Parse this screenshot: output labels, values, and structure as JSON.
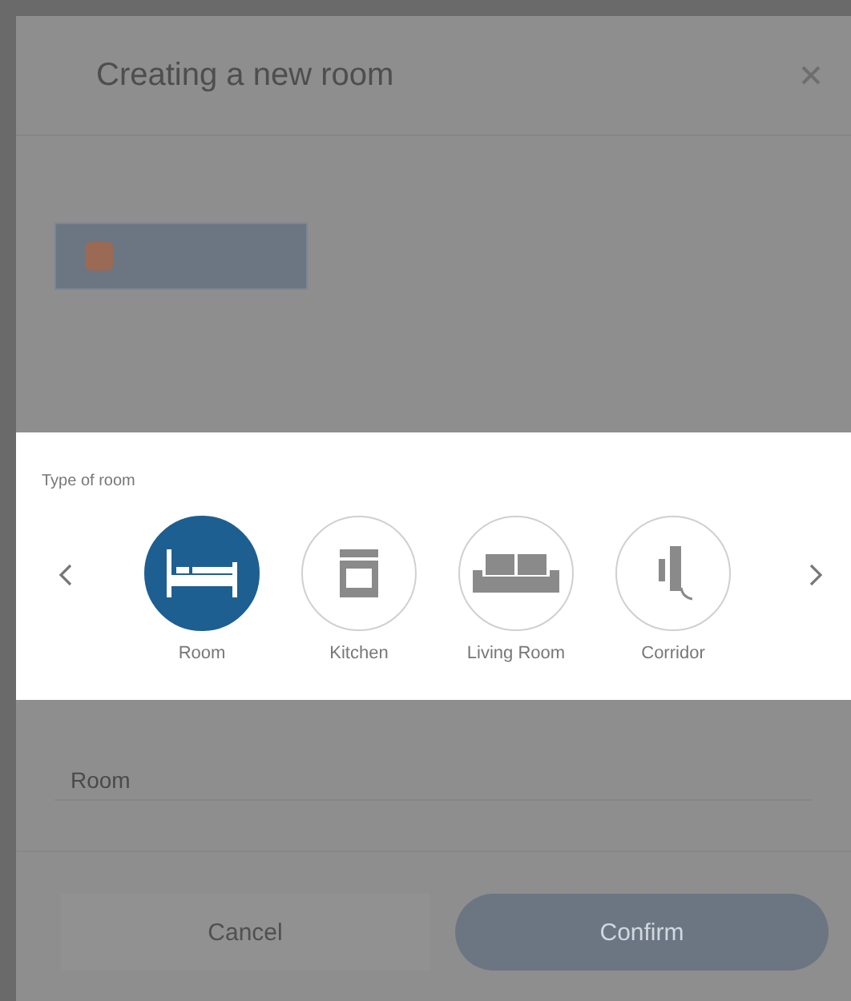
{
  "dialog": {
    "title": "Creating a new room"
  },
  "room_type_picker": {
    "label": "Type of room",
    "options": [
      {
        "label": "Room",
        "kind": "bed",
        "selected": true
      },
      {
        "label": "Kitchen",
        "kind": "oven",
        "selected": false
      },
      {
        "label": "Living Room",
        "kind": "sofa",
        "selected": false
      },
      {
        "label": "Corridor",
        "kind": "door",
        "selected": false
      }
    ]
  },
  "name_field": {
    "value": "Room"
  },
  "buttons": [
    {
      "label": "Cancel",
      "kind": "secondary"
    },
    {
      "label": "Confirm",
      "kind": "primary"
    }
  ]
}
